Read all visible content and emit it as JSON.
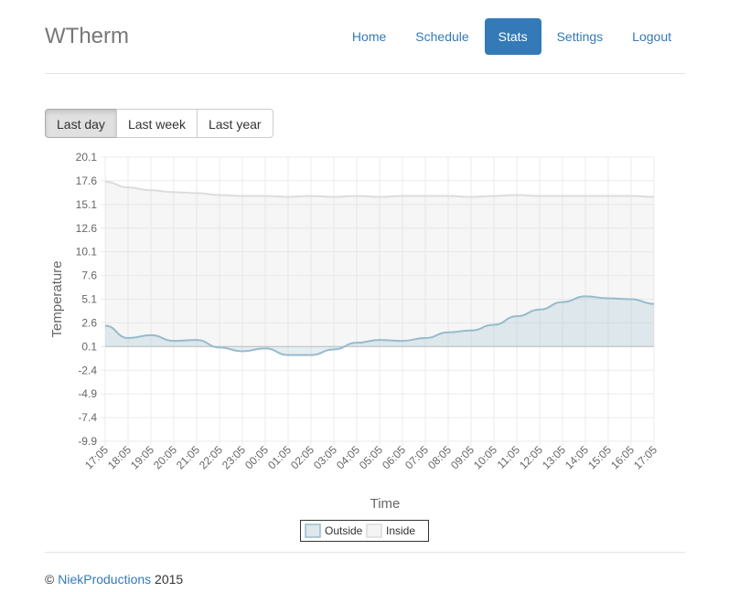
{
  "app": {
    "brand": "WTherm"
  },
  "nav": {
    "items": [
      {
        "label": "Home",
        "active": false
      },
      {
        "label": "Schedule",
        "active": false
      },
      {
        "label": "Stats",
        "active": true
      },
      {
        "label": "Settings",
        "active": false
      },
      {
        "label": "Logout",
        "active": false
      }
    ]
  },
  "range": {
    "buttons": [
      {
        "label": "Last day",
        "active": true
      },
      {
        "label": "Last week",
        "active": false
      },
      {
        "label": "Last year",
        "active": false
      }
    ]
  },
  "chart_data": {
    "type": "area",
    "xlabel": "Time",
    "ylabel": "Temperature",
    "ylim": [
      -9.9,
      20.1
    ],
    "yticks": [
      "20.1",
      "17.6",
      "15.1",
      "12.6",
      "10.1",
      "7.6",
      "5.1",
      "2.6",
      "0.1",
      "-2.4",
      "-4.9",
      "-7.4",
      "-9.9"
    ],
    "x": [
      "17:05",
      "18:05",
      "19:05",
      "20:05",
      "21:05",
      "22:05",
      "23:05",
      "00:05",
      "01:05",
      "02:05",
      "03:05",
      "04:05",
      "05:05",
      "06:05",
      "07:05",
      "08:05",
      "09:05",
      "10:05",
      "11:05",
      "12:05",
      "13:05",
      "14:05",
      "15:05",
      "16:05",
      "17:05"
    ],
    "grid": true,
    "legend_position": "bottom",
    "series": [
      {
        "name": "Outside",
        "color": "#97bbcd",
        "values": [
          2.3,
          1.0,
          1.3,
          0.7,
          0.8,
          0.0,
          -0.4,
          -0.1,
          -0.8,
          -0.8,
          -0.2,
          0.5,
          0.8,
          0.7,
          1.0,
          1.6,
          1.8,
          2.4,
          3.3,
          4.0,
          4.8,
          5.4,
          5.2,
          5.1,
          4.6
        ]
      },
      {
        "name": "Inside",
        "color": "#dcdcdc",
        "values": [
          17.5,
          16.9,
          16.6,
          16.4,
          16.3,
          16.1,
          16.0,
          16.0,
          15.9,
          16.0,
          15.9,
          16.0,
          15.9,
          16.0,
          16.0,
          16.0,
          15.9,
          16.0,
          16.1,
          16.0,
          16.0,
          16.0,
          16.0,
          16.0,
          15.9
        ]
      }
    ]
  },
  "footer": {
    "copyright": "©",
    "link": "NiekProductions",
    "year": "2015"
  }
}
